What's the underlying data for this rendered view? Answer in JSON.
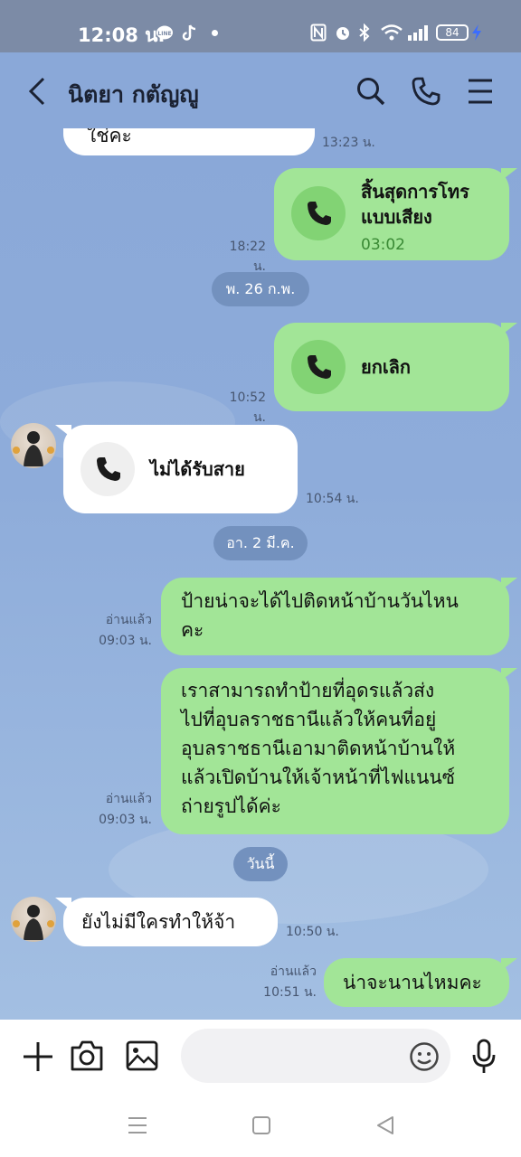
{
  "status_bar": {
    "time": "12:08 น.",
    "battery": "84",
    "icons": [
      "line-app-icon",
      "tiktok-icon",
      "nfc-icon",
      "alarm-icon",
      "bluetooth-icon",
      "wifi-icon",
      "signal-icon",
      "battery-icon",
      "charging-icon"
    ]
  },
  "header": {
    "contact_name": "นิตยา กตัญญู",
    "icons": [
      "back-icon",
      "search-icon",
      "phone-icon",
      "menu-icon"
    ]
  },
  "messages": [
    {
      "side": "in",
      "text": "ใช่คะ",
      "time": "13:23 น."
    },
    {
      "side": "out",
      "type": "call",
      "title": "สิ้นสุดการโทร แบบเสียง",
      "duration": "03:02",
      "time": "18:22 น."
    },
    {
      "type": "date",
      "text": "พ. 26 ก.พ."
    },
    {
      "side": "out",
      "type": "call",
      "title": "ยกเลิก",
      "time": "10:52 น."
    },
    {
      "side": "in",
      "type": "call",
      "title": "ไม่ได้รับสาย",
      "time": "10:54 น."
    },
    {
      "type": "date",
      "text": "อา. 2 มี.ค."
    },
    {
      "side": "out",
      "read": "อ่านแล้ว",
      "time": "09:03 น.",
      "lines": [
        "ป้ายน่าจะได้ไปติดหน้าบ้านวันไหน",
        "คะ"
      ]
    },
    {
      "side": "out",
      "read": "อ่านแล้ว",
      "time": "09:03 น.",
      "lines": [
        "เราสามารถทำป้ายที่อุดรแล้วส่ง",
        "ไปที่อุบลราชธานีแล้วให้คนที่อยู่",
        "อุบลราชธานีเอามาติดหน้าบ้านให้",
        "แล้วเปิดบ้านให้เจ้าหน้าที่ไฟแนนซ์",
        "ถ่ายรูปได้ค่ะ"
      ]
    },
    {
      "type": "date",
      "text": "วันนี้"
    },
    {
      "side": "in",
      "text": "ยังไม่มีใครทำให้จ้า",
      "time": "10:50 น."
    },
    {
      "side": "out",
      "read": "อ่านแล้ว",
      "time": "10:51 น.",
      "text": "น่าจะนานไหมคะ"
    }
  ],
  "input_bar": {
    "placeholder": "",
    "icons": [
      "plus-icon",
      "camera-icon",
      "image-icon",
      "emoji-icon",
      "microphone-icon"
    ]
  },
  "nav_bar": {
    "icons": [
      "recent-apps-icon",
      "home-icon",
      "back-nav-icon"
    ]
  },
  "colors": {
    "chat_background": "#8aa8d8",
    "outgoing_bubble": "#a2e597",
    "incoming_bubble": "#ffffff",
    "status_bar": "#7c8ba6",
    "date_pill": "#7391be",
    "call_circle": "#82d374"
  }
}
